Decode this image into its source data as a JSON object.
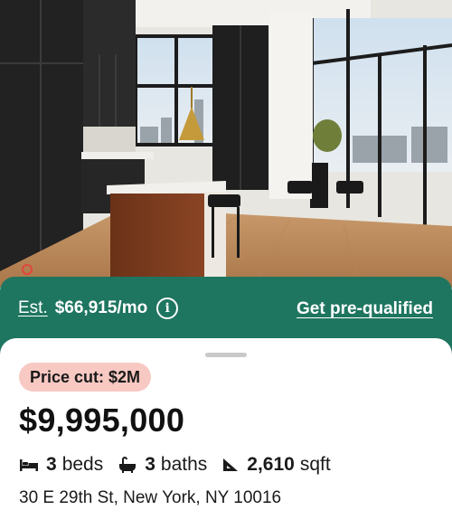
{
  "listing": {
    "photo_alt": "kitchen-photo"
  },
  "estimate_bar": {
    "est_label": "Est.",
    "est_amount": "$66,915/mo",
    "info_icon": "info-icon",
    "prequalify_label": "Get pre-qualified"
  },
  "details": {
    "price_cut_badge": "Price cut: $2M",
    "price": "$9,995,000",
    "beds_count": "3",
    "beds_label": "beds",
    "baths_count": "3",
    "baths_label": "baths",
    "sqft_count": "2,610",
    "sqft_label": "sqft",
    "address": "30 E 29th St, New York, NY 10016"
  },
  "icons": [
    "bed-icon",
    "bath-icon",
    "ruler-icon",
    "info-icon"
  ],
  "colors": {
    "bar_green": "#1e7560",
    "badge_pink": "#f7c9c2",
    "text_dark": "#111111"
  }
}
